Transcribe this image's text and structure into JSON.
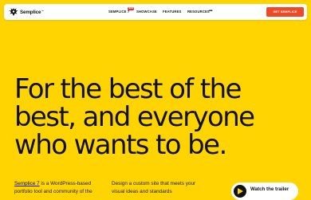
{
  "nav": {
    "brand": "Semplice",
    "brand_tm": "™",
    "links": [
      "SEMPLICE 7",
      "SHOWCASE",
      "FEATURES",
      "RESOURCES"
    ],
    "new_badge": "NEW",
    "more": "•••",
    "cta": "GET SEMPLICE"
  },
  "hero": {
    "headline_lines": [
      "For the best of the",
      "best, and everyone",
      "who wants to be."
    ],
    "intro_left_link": "Semplice 7",
    "intro_left_rest": " is a WordPress-based portfolio tool and community of the",
    "intro_right": "Design a custom site that meets your visual ideas and standards",
    "trailer_label": "Watch the trailer"
  },
  "colors": {
    "background": "#ffd400",
    "cta": "#ee4a28",
    "badge": "#e8312f",
    "text": "#111111"
  },
  "icons": {
    "logo": "semplice-eagle-logo",
    "play": "play-icon"
  }
}
